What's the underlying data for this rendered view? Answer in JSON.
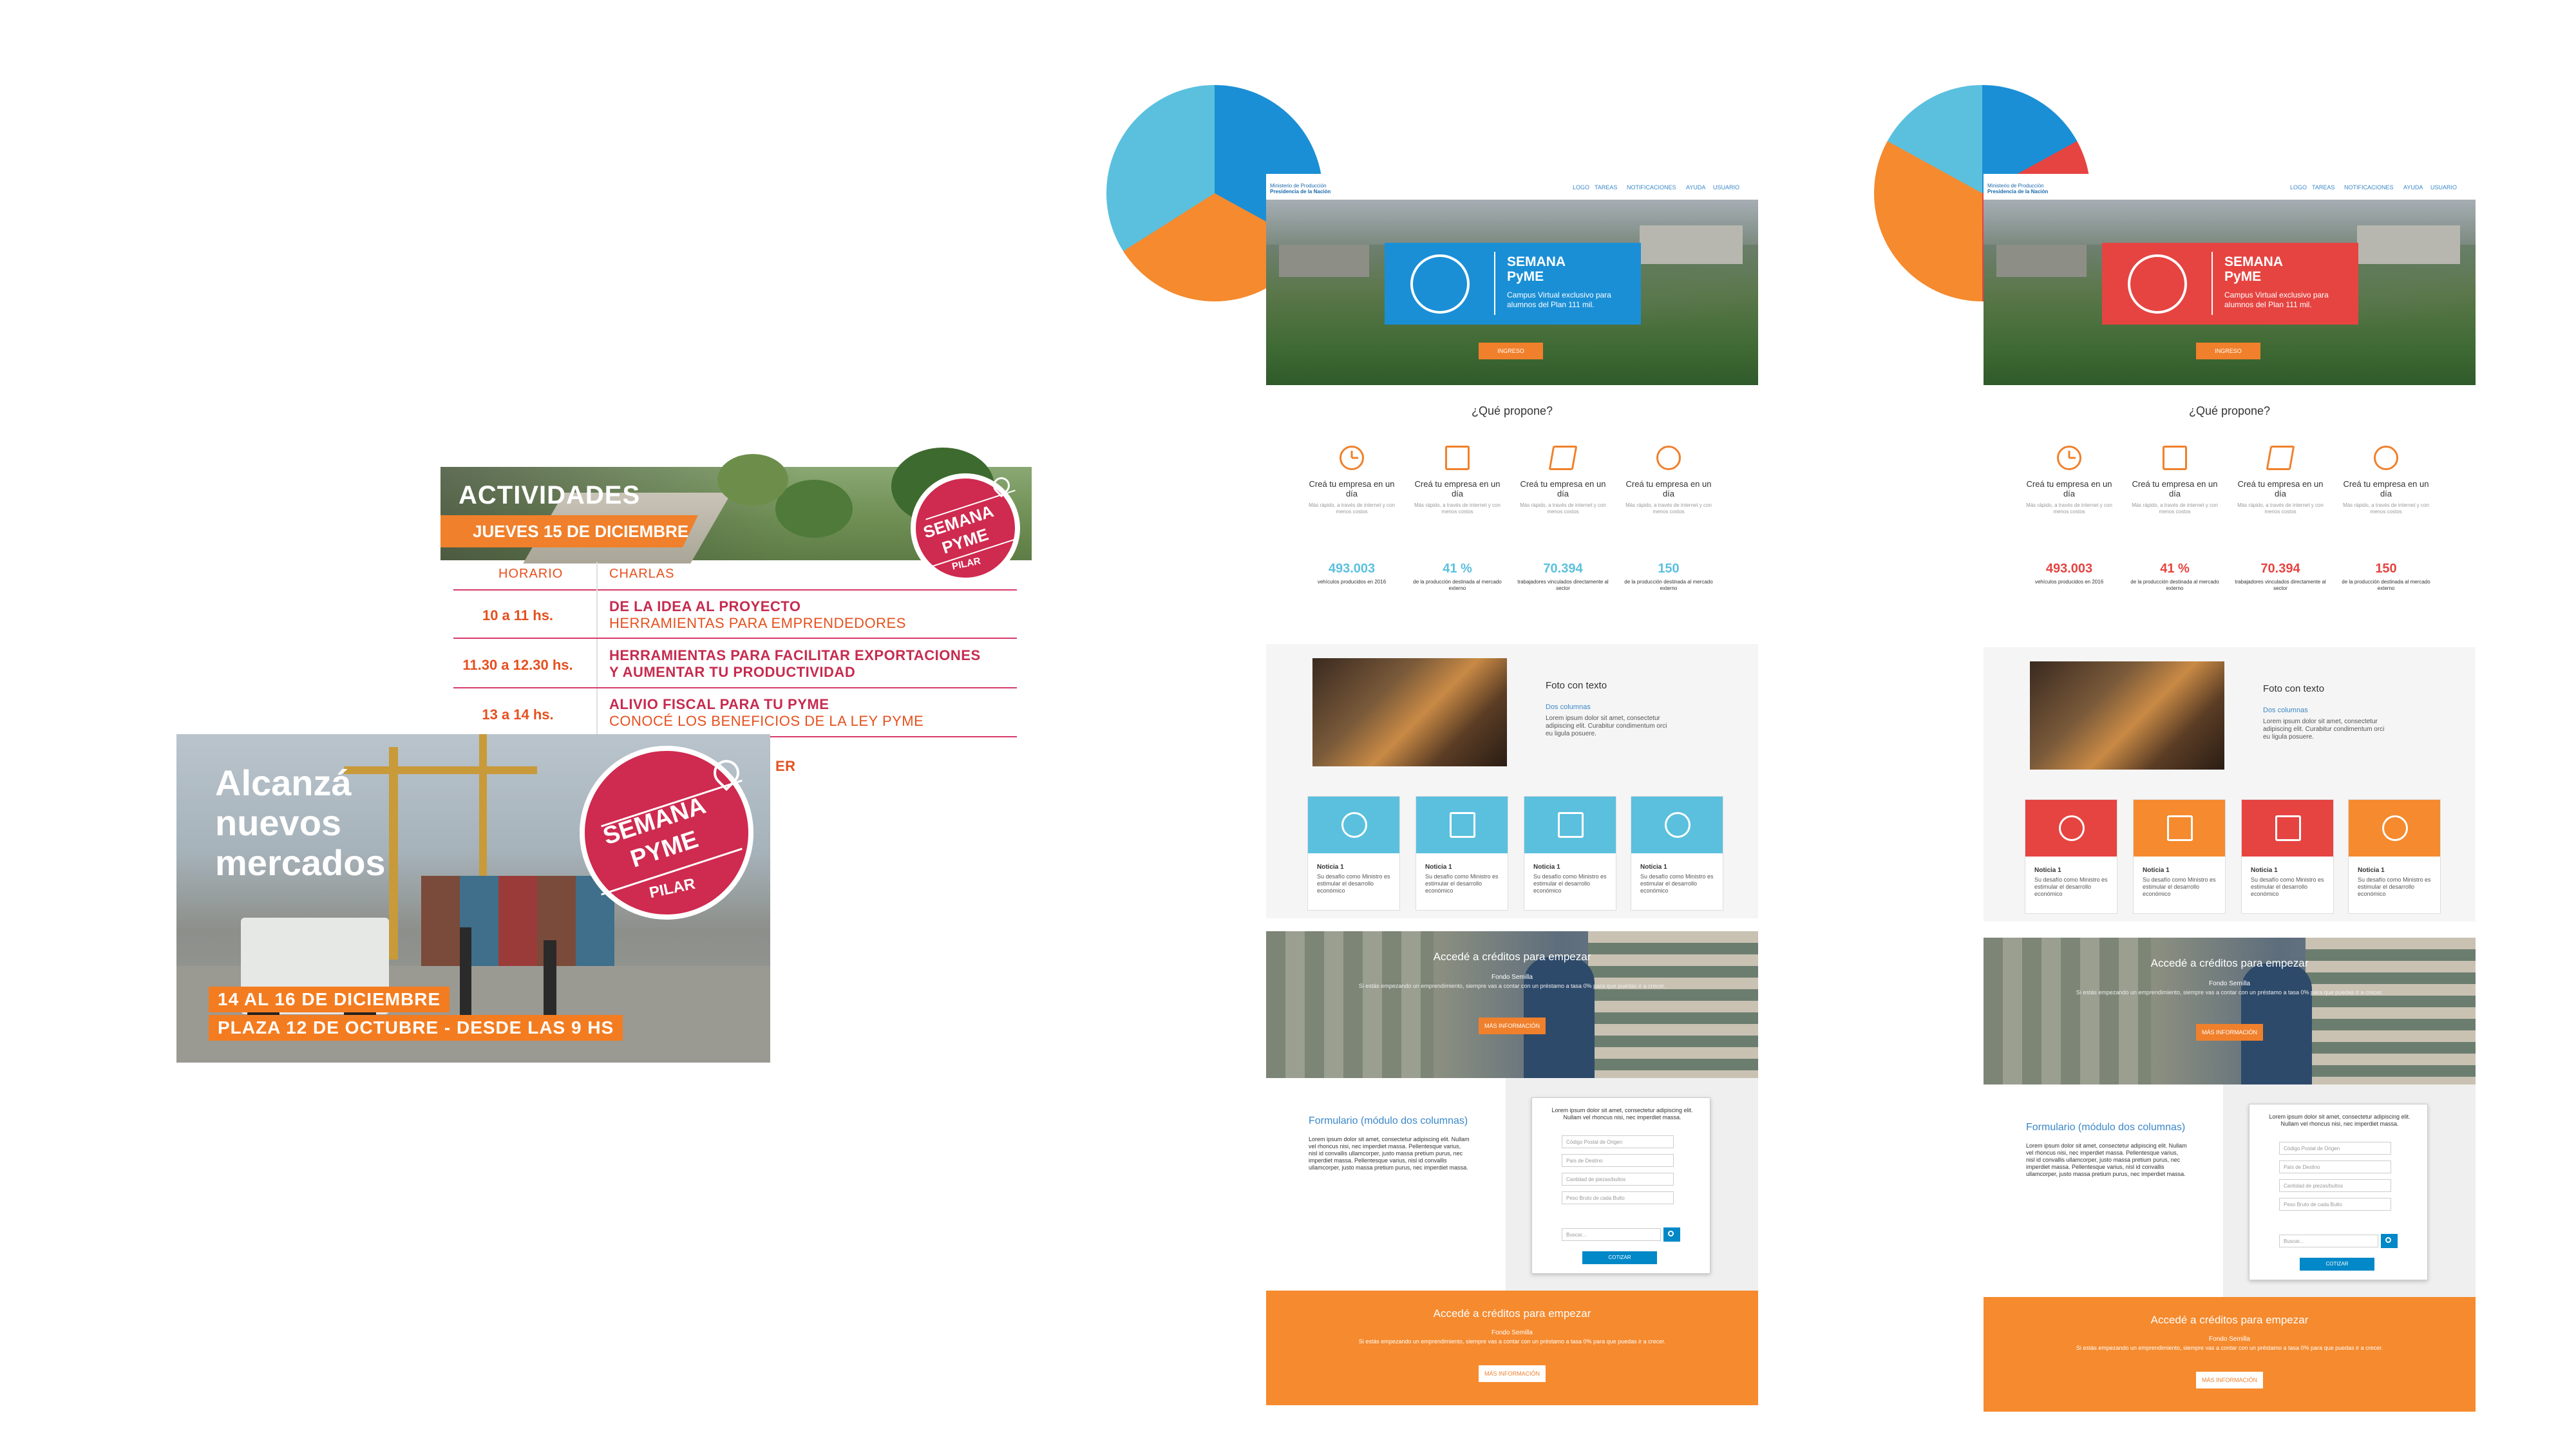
{
  "colors": {
    "orange": "#f0802b",
    "blue": "#1a9ad9",
    "light_blue": "#5bc0de",
    "red": "#e64441",
    "crimson": "#cf2a4f"
  },
  "pies": [
    {
      "slices": [
        {
          "color": "#1a8fd6",
          "fraction": 0.33
        },
        {
          "color": "#f58a2e",
          "fraction": 0.33
        },
        {
          "color": "#5bc0de",
          "fraction": 0.34
        }
      ]
    },
    {
      "slices": [
        {
          "color": "#1a8fd6",
          "fraction": 0.17
        },
        {
          "color": "#e64441",
          "fraction": 0.33
        },
        {
          "color": "#f58a2e",
          "fraction": 0.33
        },
        {
          "color": "#5bc0de",
          "fraction": 0.17
        }
      ]
    }
  ],
  "badge": {
    "line1": "SEMANA",
    "line2": "PYME",
    "line3": "PILAR"
  },
  "actividades": {
    "title": "ACTIVIDADES",
    "date": "JUEVES 15 DE DICIEMBRE",
    "col_horario": "HORARIO",
    "col_charlas": "CHARLAS",
    "rows": [
      {
        "time": "10 a 11 hs.",
        "line1": "DE LA IDEA AL PROYECTO",
        "line2": "HERRAMIENTAS PARA EMPRENDEDORES"
      },
      {
        "time": "11.30 a 12.30 hs.",
        "line1": "HERRAMIENTAS PARA FACILITAR EXPORTACIONES",
        "line2": "Y AUMENTAR TU PRODUCTIVIDAD"
      },
      {
        "time": "13 a 14 hs.",
        "line1": "ALIVIO FISCAL PARA TU PYME",
        "line2": "CONOCÉ LOS BENEFICIOS DE LA LEY PYME"
      }
    ],
    "partial_text": "ER"
  },
  "ad": {
    "title_lines": [
      "Alcanzá",
      "nuevos",
      "mercados"
    ],
    "strip1": "14 AL 16 DE DICIEMBRE",
    "strip2": "PLAZA 12 DE OCTUBRE - DESDE LAS 9 HS"
  },
  "site": {
    "logo_line1": "Ministerio de Producción",
    "logo_line2": "Presidencia de la Nación",
    "nav": [
      "LOGO",
      "TAREAS",
      "NOTIFICACIONES",
      "AYUDA",
      "USUARIO"
    ],
    "hero_title_1": "SEMANA",
    "hero_title_2": "PyME",
    "hero_sub": "Campus Virtual exclusivo para alumnos del Plan 111 mil.",
    "hero_button": "INGRESO",
    "propone": "¿Qué propone?",
    "features": [
      {
        "icon": "clock-icon",
        "title": "Creá tu empresa en un día",
        "desc": "Más rápido, a través de internet y con menos costos"
      },
      {
        "icon": "archive-icon",
        "title": "Creá tu empresa en un día",
        "desc": "Más rápido, a través de internet y con menos costos"
      },
      {
        "icon": "book-icon",
        "title": "Creá tu empresa en un día",
        "desc": "Más rápido, a través de internet y con menos costos"
      },
      {
        "icon": "chat-icon",
        "title": "Creá tu empresa en un día",
        "desc": "Más rápido, a través de internet y con menos costos"
      }
    ],
    "stats": [
      {
        "value": "493.003",
        "label": "vehículos producidos en 2016"
      },
      {
        "value": "41 %",
        "label": "de la producción destinada al mercado externo"
      },
      {
        "value": "70.394",
        "label": "trabajadores vinculados directamente al sector"
      },
      {
        "value": "150",
        "label": "de la producción destinada al mercado externo"
      }
    ],
    "foto_title": "Foto con texto",
    "foto_sub": "Dos columnas",
    "foto_text": "Lorem ipsum dolor sit amet, consectetur adipiscing elit. Curabitur condimentum orci eu ligula posuere.",
    "cards": [
      {
        "icon": "clock-icon",
        "title": "Noticia 1",
        "desc": "Su desafío como Ministro es estimular el desarrollo económico"
      },
      {
        "icon": "archive-icon",
        "title": "Noticia 1",
        "desc": "Su desafío como Ministro es estimular el desarrollo económico"
      },
      {
        "icon": "book-icon",
        "title": "Noticia 1",
        "desc": "Su desafío como Ministro es estimular el desarrollo económico"
      },
      {
        "icon": "chat-icon",
        "title": "Noticia 1",
        "desc": "Su desafío como Ministro es estimular el desarrollo económico"
      }
    ],
    "banner_title": "Accedé a créditos para empezar",
    "banner_fs": "Fondo Semilla",
    "banner_fs_text": "Si estás empezando un emprendimiento, siempre vas a contar con un préstamo a tasa 0% para que puedas ir a crecer.",
    "banner_button": "MÁS INFORMACIÓN",
    "form_title": "Formulario (módulo dos columnas)",
    "form_text": "Lorem ipsum dolor sit amet, consectetur adipiscing elit. Nullam vel rhoncus nisi, nec imperdiet massa. Pellentesque varius, nisl id convallis ullamcorper, justo massa pretium purus, nec imperdiet massa. Pellentesque varius, nisl id convallis ullamcorper, justo massa pretium purus, nec imperdiet massa.",
    "form_card_text": "Lorem ipsum dolor sit amet, consectetur adipiscing elit. Nullam vel rhoncus nisi, nec imperdiet massa.",
    "fields": [
      "Código Postal de Origen",
      "País de Destino",
      "Cantidad de piezas/bultos",
      "Peso Bruto de cada Bulto",
      "Buscar..."
    ],
    "form_button": "COTIZAR",
    "foot_title": "Accedé a créditos para empezar",
    "foot_fs": "Fondo Semilla",
    "foot_fs_text": "Si estás empezando un emprendimiento, siempre vas a contar con un préstamo a tasa 0% para que puedas ir a crecer.",
    "foot_button": "MÁS INFORMACIÓN"
  }
}
